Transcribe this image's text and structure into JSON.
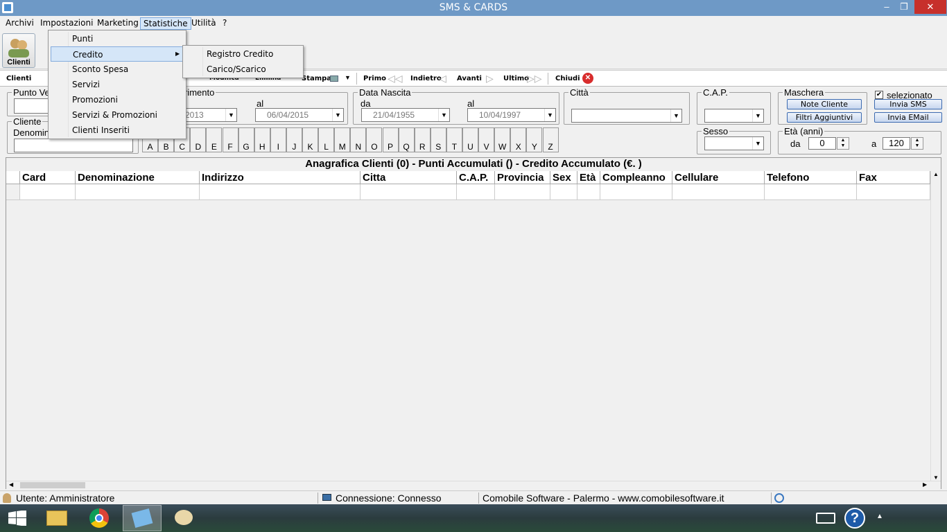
{
  "window": {
    "title": "SMS & CARDS",
    "min": "‒",
    "max": "❐",
    "close": "✕"
  },
  "menubar": [
    "Archivi",
    "Impostazioni",
    "Marketing",
    "Statistiche",
    "Utilità",
    "?"
  ],
  "ribbon": {
    "clienti": "Clienti"
  },
  "toolbar": {
    "clienti": "Clienti",
    "modifica": "Modifica",
    "elimina": "Elimina",
    "stampa": "Stampa",
    "primo": "Primo",
    "indietro": "Indietro",
    "avanti": "Avanti",
    "ultimo": "Ultimo",
    "chiudi": "Chiudi"
  },
  "filters": {
    "punto_vendita": "Punto Ve",
    "riferimento": "rimento",
    "ref_from": "2013",
    "al": "al",
    "ref_to": "06/04/2015",
    "data_nascita": "Data Nascita",
    "da": "da",
    "nascita_from": "21/04/1955",
    "nascita_to": "10/04/1997",
    "citta": "Città",
    "cap": "C.A.P.",
    "sesso": "Sesso",
    "maschera": "Maschera",
    "note_cliente": "Note Cliente",
    "filtri_aggiuntivi": "Filtri Aggiuntivi",
    "selezionato": "selezionato",
    "invia_sms": "Invia SMS",
    "invia_email": "Invia EMail",
    "eta": "Età (anni)",
    "eta_da_label": "da",
    "eta_da": "0",
    "eta_a_label": "a",
    "eta_a": "120",
    "cliente": "Cliente",
    "denominazione": "Denomin"
  },
  "letters": [
    "A",
    "B",
    "C",
    "D",
    "E",
    "F",
    "G",
    "H",
    "I",
    "J",
    "K",
    "L",
    "M",
    "N",
    "O",
    "P",
    "Q",
    "R",
    "S",
    "T",
    "U",
    "V",
    "W",
    "X",
    "Y",
    "Z"
  ],
  "grid": {
    "title": "Anagrafica Clienti (0)  - Punti Accumulati () - Credito Accumulato (€. )",
    "columns": [
      "Card",
      "Denominazione",
      "Indirizzo",
      "Citta",
      "C.A.P.",
      "Provincia",
      "Sex",
      "Età",
      "Compleanno",
      "Cellulare",
      "Telefono",
      "Fax"
    ]
  },
  "status": {
    "utente": "Utente: Amministratore",
    "connessione": "Connessione: Connesso",
    "company": "Comobile Software - Palermo - www.comobilesoftware.it"
  },
  "dropdown": [
    "Punti",
    "Credito",
    "Sconto Spesa",
    "Servizi",
    "Promozioni",
    "Servizi & Promozioni",
    "Clienti Inseriti"
  ],
  "submenu": [
    "Registro Credito",
    "Carico/Scarico"
  ],
  "colors": {
    "titlebar": "#6e99c6",
    "highlight": "#d5e6f8",
    "close_red": "#c7302b"
  }
}
